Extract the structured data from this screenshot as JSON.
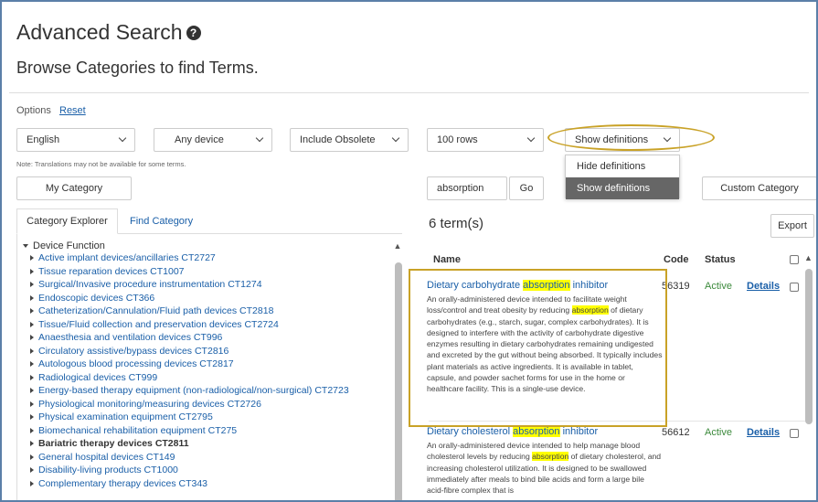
{
  "header": {
    "title": "Advanced Search",
    "help_icon_char": "?",
    "subtitle": "Browse Categories to find Terms."
  },
  "options": {
    "label": "Options",
    "reset": "Reset"
  },
  "filters": {
    "language": "English",
    "device": "Any device",
    "obsolete": "Include Obsolete",
    "rows": "100 rows",
    "definitions": "Show definitions"
  },
  "definitions_menu": {
    "options": [
      "Hide definitions",
      "Show definitions"
    ],
    "selected_index": 1
  },
  "note": "Note: Translations may not be available for some terms.",
  "buttons": {
    "my_category": "My Category",
    "go": "Go",
    "custom_category": "Custom Category",
    "export": "Export"
  },
  "search": {
    "value": "absorption"
  },
  "tabs": {
    "explorer": "Category Explorer",
    "find": "Find Category"
  },
  "tree": {
    "root": "Device Function",
    "items": [
      {
        "label": "Active implant devices/ancillaries CT2727",
        "bold": false
      },
      {
        "label": "Tissue reparation devices CT1007",
        "bold": false
      },
      {
        "label": "Surgical/Invasive procedure instrumentation CT1274",
        "bold": false
      },
      {
        "label": "Endoscopic devices CT366",
        "bold": false
      },
      {
        "label": "Catheterization/Cannulation/Fluid path devices CT2818",
        "bold": false
      },
      {
        "label": "Tissue/Fluid collection and preservation devices CT2724",
        "bold": false
      },
      {
        "label": "Anaesthesia and ventilation devices CT996",
        "bold": false
      },
      {
        "label": "Circulatory assistive/bypass devices CT2816",
        "bold": false
      },
      {
        "label": "Autologous blood processing devices CT2817",
        "bold": false
      },
      {
        "label": "Radiological devices CT999",
        "bold": false
      },
      {
        "label": "Energy-based therapy equipment (non-radiological/non-surgical) CT2723",
        "bold": false
      },
      {
        "label": "Physiological monitoring/measuring devices CT2726",
        "bold": false
      },
      {
        "label": "Physical examination equipment CT2795",
        "bold": false
      },
      {
        "label": "Biomechanical rehabilitation equipment CT275",
        "bold": false
      },
      {
        "label": "Bariatric therapy devices CT2811",
        "bold": true
      },
      {
        "label": "General hospital devices CT149",
        "bold": false
      },
      {
        "label": "Disability-living products CT1000",
        "bold": false
      },
      {
        "label": "Complementary therapy devices CT343",
        "bold": false
      }
    ]
  },
  "results": {
    "count": "6 term(s)",
    "columns": {
      "name": "Name",
      "code": "Code",
      "status": "Status"
    },
    "rows": [
      {
        "title_pre": "Dietary carbohydrate ",
        "title_mark": "absorption",
        "title_post": " inhibitor",
        "desc_pre": "An orally-administered device intended to facilitate weight loss/control and treat obesity by reducing ",
        "desc_mark": "absorption",
        "desc_post": " of dietary carbohydrates (e.g., starch, sugar, complex carbohydrates). It is designed to interfere with the activity of carbohydrate digestive enzymes resulting in dietary carbohydrates remaining undigested and excreted by the gut without being absorbed. It typically includes plant materials as active ingredients. It is available in tablet, capsule, and powder sachet forms for use in the home or healthcare facility. This is a single-use device.",
        "code": "56319",
        "status": "Active",
        "details": "Details"
      },
      {
        "title_pre": "Dietary cholesterol ",
        "title_mark": "absorption",
        "title_post": " inhibitor",
        "desc_pre": "An orally-administered device intended to help manage blood cholesterol levels by reducing ",
        "desc_mark": "absorption",
        "desc_post": " of dietary cholesterol, and increasing cholesterol utilization. It is designed to be swallowed immediately after meals to bind bile acids and form a large bile acid-fibre complex that is",
        "code": "56612",
        "status": "Active",
        "details": "Details"
      }
    ]
  },
  "colors": {
    "link": "#1a5fa8",
    "highlight": "#ffff00",
    "annotation": "#c9a227",
    "status_active": "#3c8a3c",
    "menu_selected": "#666666"
  }
}
